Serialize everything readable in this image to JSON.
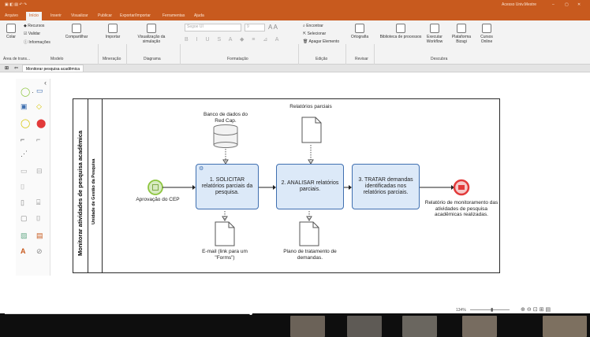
{
  "window": {
    "title": "",
    "user": "Acesso Univ.Mestre",
    "controls": [
      "–",
      "▢",
      "✕"
    ]
  },
  "tabs": [
    "Arquivo",
    "Início",
    "Inserir",
    "Visualizar",
    "Publicar",
    "Exportar/Importar",
    "Ferramentas",
    "Ajuda"
  ],
  "active_tab_index": 1,
  "ribbon": {
    "groups": [
      "Área de trans...",
      "Modelo",
      "Mineração",
      "Diagrama",
      "Formatação",
      "Edição",
      "Revisar",
      "Descubra"
    ],
    "buttons": {
      "colar": "Colar",
      "recursos": "Recursos",
      "validar": "Validar",
      "informacoes": "Informações",
      "compartilhar": "Compartilhar",
      "importar": "Importar",
      "visualizacao": "Visualização da simulação",
      "font": "Segoe UI",
      "size": "9",
      "encontrar": "Encontrar",
      "selecionar": "Selecionar",
      "apagar": "Apagar Elemento",
      "ortografia": "Ortografia",
      "biblioteca": "Biblioteca de processos",
      "executar": "Executar Workflow",
      "plataforma": "Plataforma Bizagi",
      "cursos": "Cursos Online"
    }
  },
  "doc_tab": "Monitorar pesquisa acadêmica",
  "diagram": {
    "pool_title": "Monitorar atividades de pesquisa acadêmica",
    "lane_title": "Unidade de Gestão da Pesquisa",
    "start_label": "Aprovação do CEP",
    "tasks": [
      "1. SOLICITAR relatórios parciais da pesquisa.",
      "2. ANALISAR relatórios parciais.",
      "3. TRATAR demandas identificadas nos relatórios parciais."
    ],
    "datastore_label": "Banco de dados do Red Cap.",
    "doc_top_label": "Relatórios parciais",
    "doc_bottom1_label": "E-mail (link para um \"Forms\")",
    "doc_bottom2_label": "Plano de tratamento de demandas.",
    "end_label": "Relatório de monitoramento das atividades de pesquisa acadêmicas realizadas."
  },
  "status": {
    "zoom": "134%"
  },
  "colors": {
    "accent": "#c85a1e",
    "task_fill": "#dce9f8",
    "task_border": "#3f6fb0",
    "start": "#8dc63f",
    "end": "#e23a3a"
  }
}
